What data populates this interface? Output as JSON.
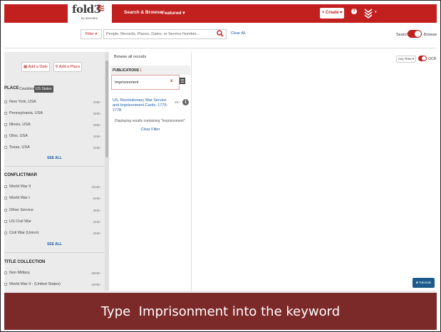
{
  "header": {
    "logo_text": "fold3",
    "logo_sub": "by ancestry",
    "nav_search_browse": "Search & Browse",
    "nav_featured": "Featured ▾",
    "create_label": "+ Create ▾",
    "help_icon": "?",
    "account_caret": "▾",
    "brand_color": "#c21f1f"
  },
  "search": {
    "filter_label": "Filter ▾",
    "placeholder": "People, Records, Places, Dates, or Service Number...",
    "clear_all": "Clear All",
    "search_label": "Search",
    "browse_label": "Browse"
  },
  "sidebar": {
    "add_date": "Add a Date",
    "add_place": "Add a Place",
    "place_title": "PLACE",
    "countries_label": "Countries",
    "country_badge": "US States",
    "place_items": [
      {
        "label": "New York, USA",
        "count": "40M+"
      },
      {
        "label": "Pennsylvania, USA",
        "count": "36M+"
      },
      {
        "label": "Illinois, USA",
        "count": "28M+"
      },
      {
        "label": "Ohio, USA",
        "count": "24M+"
      },
      {
        "label": "Texas, USA",
        "count": "22M+"
      }
    ],
    "see_all_1": "SEE ALL",
    "conflict_title": "CONFLICT/WAR",
    "conflict_items": [
      {
        "label": "World War II",
        "count": "160M+"
      },
      {
        "label": "World War I",
        "count": "64M+"
      },
      {
        "label": "Other Service",
        "count": "36M+"
      },
      {
        "label": "US Civil War",
        "count": "34M+"
      },
      {
        "label": "Civil War (Union)",
        "count": "25M+"
      }
    ],
    "see_all_2": "SEE ALL",
    "title_collection": "TITLE COLLECTION",
    "title_items": [
      {
        "label": "Non Military",
        "count": "280M+"
      },
      {
        "label": "World War II - (United States)",
        "count": "160M+"
      }
    ]
  },
  "middle": {
    "browse_all": "Browse all records",
    "publications_label": "PUBLICATIONS",
    "publications_count": "1",
    "keyword_value": "Imprisonment",
    "keyword_clear": "x",
    "result_title": "US, Revolutionary War Service and Imprisonment Cards, 1775-1778",
    "result_count": "1K+",
    "result_info_icon": "i",
    "displaying_text": "Displaying results containing \"Imprisonment\".",
    "clear_filter": "Clear Filter"
  },
  "right": {
    "any_time": "Any Time ▾",
    "ocr_label": "OCR",
    "tutorials": "Tutorials"
  },
  "caption": {
    "text": "Type  Imprisonment into the keyword",
    "bg_color": "#7c2929"
  }
}
